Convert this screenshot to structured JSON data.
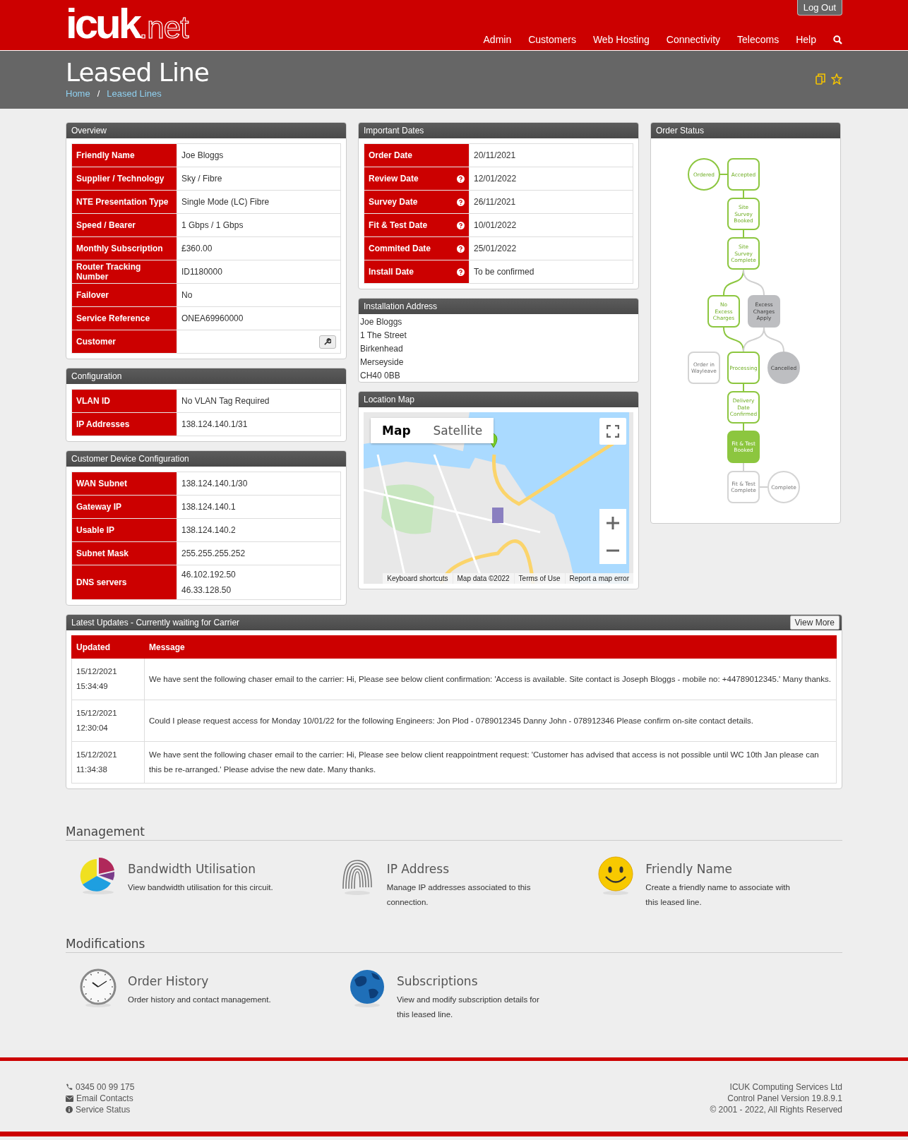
{
  "header": {
    "logo_main": "icuk",
    "logo_suffix": ".net",
    "logout": "Log Out",
    "nav": [
      "Admin",
      "Customers",
      "Web Hosting",
      "Connectivity",
      "Telecoms",
      "Help"
    ]
  },
  "page": {
    "title": "Leased Line",
    "breadcrumbs": [
      "Home",
      "Leased Lines"
    ],
    "breadcrumb_separator": "/"
  },
  "overview": {
    "title": "Overview",
    "rows": [
      {
        "label": "Friendly Name",
        "kind": "text",
        "value": "Joe Bloggs"
      },
      {
        "label": "Supplier / Technology",
        "kind": "text",
        "value": "Sky / Fibre"
      },
      {
        "label": "NTE Presentation Type",
        "kind": "text",
        "value": "Single Mode (LC) Fibre"
      },
      {
        "label": "Speed / Bearer",
        "kind": "text",
        "value": "1 Gbps / 1 Gbps"
      },
      {
        "label": "Monthly Subscription",
        "kind": "text",
        "value": "£360.00"
      },
      {
        "label": "Router Tracking Number",
        "kind": "text",
        "value": "ID1180000"
      },
      {
        "label": "Failover",
        "kind": "text",
        "value": "No"
      },
      {
        "label": "Service Reference",
        "kind": "text",
        "value": "ONEA69960000"
      },
      {
        "label": "Customer",
        "kind": "edit"
      }
    ]
  },
  "configuration": {
    "title": "Configuration",
    "rows": [
      {
        "label": "VLAN ID",
        "kind": "text",
        "value": "No VLAN Tag Required"
      },
      {
        "label": "IP Addresses",
        "kind": "text",
        "value": "138.124.140.1/31"
      }
    ]
  },
  "device_configuration": {
    "title": "Customer Device Configuration",
    "rows": [
      {
        "label": "WAN Subnet",
        "kind": "text",
        "value": "138.124.140.1/30"
      },
      {
        "label": "Gateway IP",
        "kind": "text",
        "value": "138.124.140.1"
      },
      {
        "label": "Usable IP",
        "kind": "text",
        "value": "138.124.140.2"
      },
      {
        "label": "Subnet Mask",
        "kind": "text",
        "value": "255.255.255.252"
      },
      {
        "label": "DNS servers",
        "kind": "multi",
        "values": [
          "46.102.192.50",
          "46.33.128.50"
        ]
      }
    ]
  },
  "important_dates": {
    "title": "Important Dates",
    "rows": [
      {
        "label": "Order Date",
        "value": "20/11/2021",
        "help": false
      },
      {
        "label": "Review Date",
        "value": "12/01/2022",
        "help": true
      },
      {
        "label": "Survey Date",
        "value": "26/11/2021",
        "help": true
      },
      {
        "label": "Fit & Test Date",
        "value": "10/01/2022",
        "help": true
      },
      {
        "label": "Commited Date",
        "value": "25/01/2022",
        "help": true
      },
      {
        "label": "Install Date",
        "value": "To be confirmed",
        "help": true
      }
    ]
  },
  "installation_address": {
    "title": "Installation Address",
    "lines": [
      "Joe Bloggs",
      "1 The Street",
      "Birkenhead",
      "Merseyside",
      "CH40 0BB"
    ]
  },
  "location_map": {
    "title": "Location Map",
    "map_types": [
      {
        "label": "Map",
        "selected": true
      },
      {
        "label": "Satellite",
        "selected": false
      }
    ],
    "attribution": [
      "Keyboard shortcuts",
      "Map data ©2022",
      "Terms of Use",
      "Report a map error"
    ]
  },
  "order_status": {
    "title": "Order Status",
    "nodes": [
      {
        "lines": [
          "Ordered"
        ],
        "kind": "circle",
        "completed": true,
        "current": false,
        "inactive": false
      },
      {
        "lines": [
          "Accepted"
        ],
        "kind": "box",
        "completed": true,
        "current": false,
        "inactive": false
      },
      {
        "lines": [
          "Site",
          "Survey",
          "Booked"
        ],
        "kind": "box",
        "completed": true,
        "current": false,
        "inactive": false
      },
      {
        "lines": [
          "Site",
          "Survey",
          "Complete"
        ],
        "kind": "box",
        "completed": true,
        "current": false,
        "inactive": false
      },
      {
        "lines": [
          "No",
          "Excess",
          "Charges"
        ],
        "kind": "box",
        "completed": true,
        "current": false,
        "inactive": false
      },
      {
        "lines": [
          "Excess",
          "Charges",
          "Apply"
        ],
        "kind": "box",
        "completed": false,
        "current": false,
        "inactive": true
      },
      {
        "lines": [
          "Order in",
          "Wayleave"
        ],
        "kind": "box",
        "completed": false,
        "current": false,
        "inactive": false
      },
      {
        "lines": [
          "Processing"
        ],
        "kind": "box",
        "completed": true,
        "current": false,
        "inactive": false
      },
      {
        "lines": [
          "Cancelled"
        ],
        "kind": "circle",
        "completed": false,
        "current": false,
        "inactive": true
      },
      {
        "lines": [
          "Delivery",
          "Date",
          "Confirmed"
        ],
        "kind": "box",
        "completed": true,
        "current": false,
        "inactive": false
      },
      {
        "lines": [
          "Fit & Test",
          "Booked"
        ],
        "kind": "box",
        "completed": true,
        "current": true,
        "inactive": false
      },
      {
        "lines": [
          "Fit & Test",
          "Complete"
        ],
        "kind": "box",
        "completed": false,
        "current": false,
        "inactive": false
      },
      {
        "lines": [
          "Complete"
        ],
        "kind": "circle",
        "completed": false,
        "current": false,
        "inactive": false
      }
    ]
  },
  "updates": {
    "title": "Latest Updates - Currently waiting for Carrier",
    "view_more": "View More",
    "columns": [
      "Updated",
      "Message"
    ],
    "rows": [
      {
        "date": "15/12/2021",
        "time": "15:34:49",
        "message": "We have sent the following chaser email to the carrier: Hi, Please see below client confirmation: 'Access is available. Site contact is Joseph Bloggs - mobile no: +44789012345.' Many thanks."
      },
      {
        "date": "15/12/2021",
        "time": "12:30:04",
        "message": "Could I please request access for Monday 10/01/22 for the following Engineers: Jon Plod - 0789012345 Danny John - 078912346 Please confirm on-site contact details."
      },
      {
        "date": "15/12/2021",
        "time": "11:34:38",
        "message": "We have sent the following chaser email to the carrier: Hi, Please see below client reappointment request: 'Customer has advised that access is not possible until WC 10th Jan please can this be re-arranged.' Please advise the new date. Many thanks."
      }
    ]
  },
  "sections": [
    {
      "title": "Management",
      "items": [
        {
          "kind": "pie",
          "title": "Bandwidth Utilisation",
          "text": "View bandwidth utilisation for this circuit."
        },
        {
          "kind": "fingerprint",
          "title": "IP Address",
          "text": "Manage IP addresses associated to this connection."
        },
        {
          "kind": "smiley",
          "title": "Friendly Name",
          "text": "Create a friendly name to associate with this leased line."
        }
      ]
    },
    {
      "title": "Modifications",
      "items": [
        {
          "kind": "clock",
          "title": "Order History",
          "text": "Order history and contact management."
        },
        {
          "kind": "globe",
          "title": "Subscriptions",
          "text": "View and modify subscription details for this leased line."
        }
      ]
    }
  ],
  "footer": {
    "contacts": [
      {
        "kind": "phone",
        "text": "0345 00 99 175"
      },
      {
        "kind": "mail",
        "text": "Email Contacts"
      },
      {
        "kind": "info",
        "text": "Service Status"
      }
    ],
    "company": [
      "ICUK Computing Services Ltd",
      "Control Panel Version 19.8.9.1",
      "© 2001 - 2022, All Rights Reserved"
    ]
  }
}
